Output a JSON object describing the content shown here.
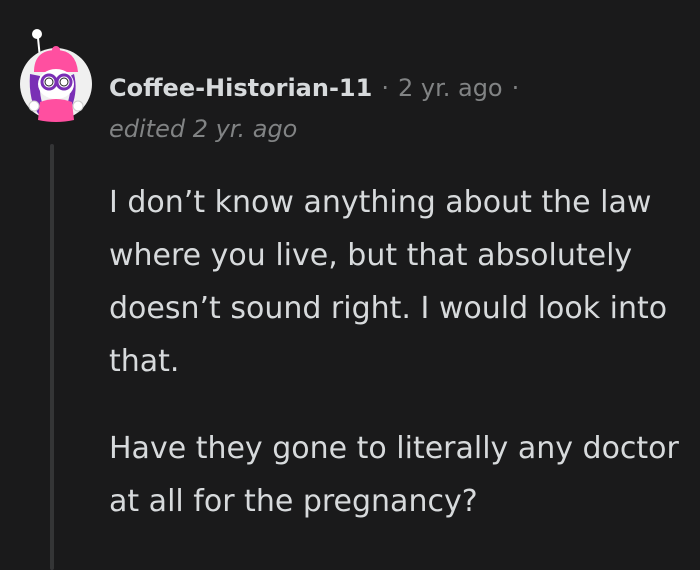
{
  "comment": {
    "author": "Coffee-Historian-11",
    "separator": "·",
    "age": "2 yr. ago",
    "edited_label": "edited 2 yr. ago",
    "paragraphs": [
      "I don’t know anything about the law where you live, but that absolutely doesn’t sound right. I would look into that.",
      "Have they gone to literally any doctor at all for the pregnancy?"
    ]
  },
  "avatar": {
    "icon": "snoo-avatar-icon",
    "colors": {
      "hat": "#ff4fa0",
      "hair": "#7a2fb5",
      "glasses": "#ffffff",
      "shirt": "#ff4fa0",
      "background": "#f0f0f0"
    }
  },
  "colors": {
    "background": "#1a1a1b",
    "text": "#d7dadc",
    "muted": "#818384",
    "thread_line": "#343536"
  }
}
